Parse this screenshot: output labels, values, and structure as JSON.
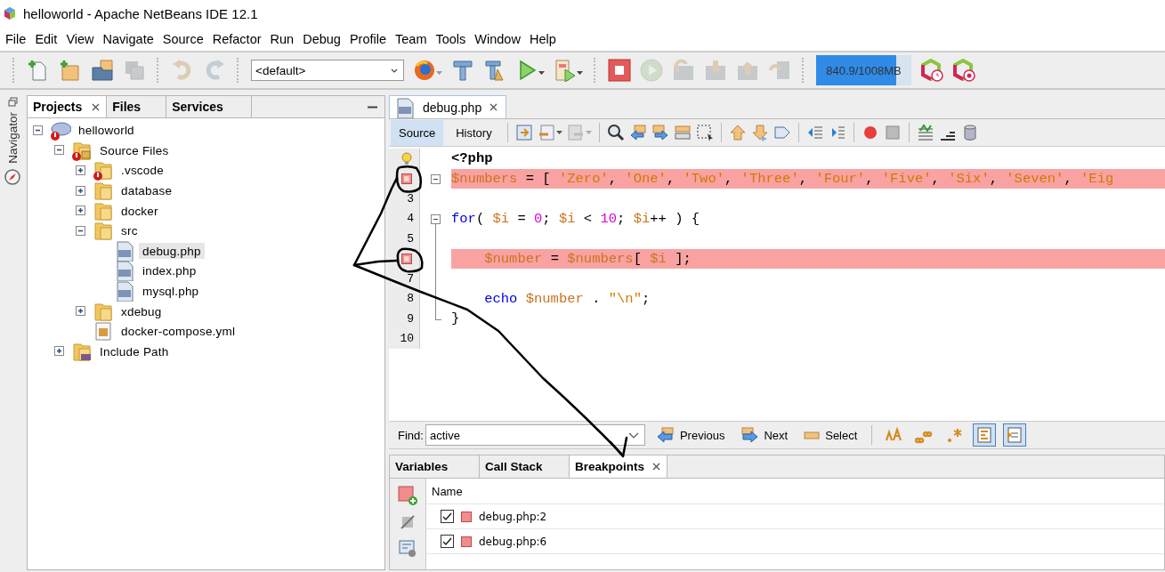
{
  "window": {
    "title": "helloworld - Apache NetBeans IDE 12.1"
  },
  "menu": [
    "File",
    "Edit",
    "View",
    "Navigate",
    "Source",
    "Refactor",
    "Run",
    "Debug",
    "Profile",
    "Team",
    "Tools",
    "Window",
    "Help"
  ],
  "toolbar": {
    "configuration": "<default>",
    "memory": {
      "text": "840.9/1008MB",
      "level": 0.84
    }
  },
  "navigator": {
    "label": "Navigator"
  },
  "projects_panel": {
    "tabs": [
      {
        "label": "Projects",
        "selected": true
      },
      {
        "label": "Files",
        "selected": false
      },
      {
        "label": "Services",
        "selected": false
      }
    ],
    "tree": [
      {
        "label": "helloworld",
        "kind": "project",
        "error": true,
        "selected": false,
        "expanded": true,
        "children": [
          {
            "label": "Source Files",
            "kind": "source-root",
            "error": true,
            "selected": false,
            "expanded": true,
            "children": [
              {
                "label": ".vscode",
                "kind": "folder",
                "error": true,
                "selected": false,
                "expanded": false
              },
              {
                "label": "database",
                "kind": "folder",
                "error": false,
                "selected": false,
                "expanded": false
              },
              {
                "label": "docker",
                "kind": "folder",
                "error": false,
                "selected": false,
                "expanded": false
              },
              {
                "label": "src",
                "kind": "folder",
                "error": false,
                "selected": false,
                "expanded": true,
                "children": [
                  {
                    "label": "debug.php",
                    "kind": "php-file",
                    "error": false,
                    "selected": true
                  },
                  {
                    "label": "index.php",
                    "kind": "php-file",
                    "error": false,
                    "selected": false
                  },
                  {
                    "label": "mysql.php",
                    "kind": "php-file",
                    "error": false,
                    "selected": false
                  }
                ]
              },
              {
                "label": "xdebug",
                "kind": "folder",
                "error": false,
                "selected": false,
                "expanded": false
              },
              {
                "label": "docker-compose.yml",
                "kind": "yml-file",
                "error": false,
                "selected": false
              }
            ]
          },
          {
            "label": "Include Path",
            "kind": "include-path",
            "error": false,
            "selected": false,
            "expanded": false
          }
        ]
      }
    ]
  },
  "editor": {
    "tabs": [
      {
        "label": "debug.php",
        "selected": true
      }
    ],
    "views": [
      {
        "label": "Source",
        "selected": true
      },
      {
        "label": "History",
        "selected": false
      }
    ],
    "lines": [
      {
        "hint": true,
        "breakpoint": false,
        "tokens": [
          {
            "kind": "tag",
            "text": "<?php"
          }
        ]
      },
      {
        "hint": false,
        "breakpoint": true,
        "foldable": true,
        "tokens": [
          {
            "kind": "var",
            "text": "$numbers"
          },
          {
            "kind": "plain",
            "text": " = [ "
          },
          {
            "kind": "string",
            "text": "'Zero'"
          },
          {
            "kind": "plain",
            "text": ", "
          },
          {
            "kind": "string",
            "text": "'One'"
          },
          {
            "kind": "plain",
            "text": ", "
          },
          {
            "kind": "string",
            "text": "'Two'"
          },
          {
            "kind": "plain",
            "text": ", "
          },
          {
            "kind": "string",
            "text": "'Three'"
          },
          {
            "kind": "plain",
            "text": ", "
          },
          {
            "kind": "string",
            "text": "'Four'"
          },
          {
            "kind": "plain",
            "text": ", "
          },
          {
            "kind": "string",
            "text": "'Five'"
          },
          {
            "kind": "plain",
            "text": ", "
          },
          {
            "kind": "string",
            "text": "'Six'"
          },
          {
            "kind": "plain",
            "text": ", "
          },
          {
            "kind": "string",
            "text": "'Seven'"
          },
          {
            "kind": "plain",
            "text": ", "
          },
          {
            "kind": "string",
            "text": "'Eig"
          }
        ]
      },
      {
        "number": "3",
        "hint": false,
        "breakpoint": false
      },
      {
        "number": "4",
        "hint": false,
        "breakpoint": false,
        "foldable": true,
        "tokens": [
          {
            "kind": "keyword",
            "text": "for"
          },
          {
            "kind": "plain",
            "text": "( "
          },
          {
            "kind": "var",
            "text": "$i"
          },
          {
            "kind": "plain",
            "text": " = "
          },
          {
            "kind": "number",
            "text": "0"
          },
          {
            "kind": "plain",
            "text": "; "
          },
          {
            "kind": "var",
            "text": "$i"
          },
          {
            "kind": "plain",
            "text": " < "
          },
          {
            "kind": "number",
            "text": "10"
          },
          {
            "kind": "plain",
            "text": "; "
          },
          {
            "kind": "var",
            "text": "$i"
          },
          {
            "kind": "plain",
            "text": "++ ) {"
          }
        ]
      },
      {
        "number": "5",
        "hint": false,
        "breakpoint": false,
        "in_block": true
      },
      {
        "hint": false,
        "breakpoint": true,
        "in_block": true,
        "indent": true,
        "tokens": [
          {
            "kind": "var",
            "text": "$number"
          },
          {
            "kind": "plain",
            "text": " = "
          },
          {
            "kind": "var",
            "text": "$numbers"
          },
          {
            "kind": "plain",
            "text": "[ "
          },
          {
            "kind": "var",
            "text": "$i"
          },
          {
            "kind": "plain",
            "text": " ];"
          }
        ]
      },
      {
        "number": "7",
        "hint": false,
        "breakpoint": false,
        "in_block": true
      },
      {
        "number": "8",
        "hint": false,
        "breakpoint": false,
        "in_block": true,
        "indent": true,
        "tokens": [
          {
            "kind": "keyword",
            "text": "echo"
          },
          {
            "kind": "var",
            "text": "$number",
            "space_before": true
          },
          {
            "kind": "plain",
            "text": " . "
          },
          {
            "kind": "string",
            "text": "\"\\n\""
          },
          {
            "kind": "plain",
            "text": ";"
          }
        ]
      },
      {
        "number": "9",
        "hint": false,
        "breakpoint": false,
        "block_end": true,
        "tokens": [
          {
            "kind": "plain",
            "text": "}"
          }
        ]
      },
      {
        "number": "10",
        "hint": false,
        "breakpoint": false
      }
    ]
  },
  "find": {
    "label": "Find:",
    "value": "active",
    "buttons": [
      "Previous",
      "Next",
      "Select"
    ],
    "toggles": [
      {
        "selected": false
      },
      {
        "selected": false
      },
      {
        "selected": false
      },
      {
        "selected": true
      },
      {
        "selected": true
      }
    ]
  },
  "debugger": {
    "tabs": [
      {
        "label": "Variables",
        "selected": false
      },
      {
        "label": "Call Stack",
        "selected": false
      },
      {
        "label": "Breakpoints",
        "selected": true
      }
    ],
    "columns": [
      "Name"
    ],
    "breakpoints": [
      {
        "name": "debug.php:2",
        "checked": true
      },
      {
        "name": "debug.php:6",
        "checked": true
      }
    ]
  }
}
